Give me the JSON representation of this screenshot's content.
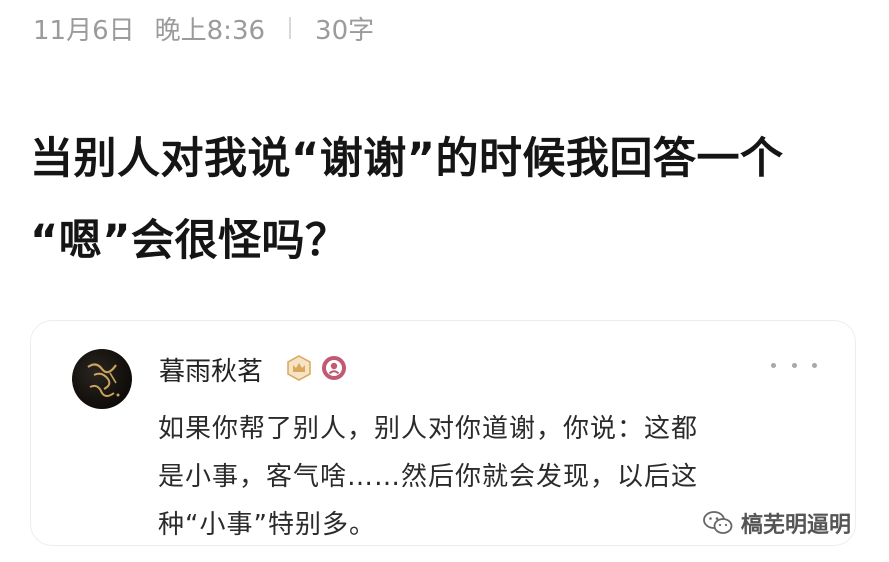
{
  "meta": {
    "date": "11月6日",
    "time": "晚上8:36",
    "word_count": "30字"
  },
  "question": {
    "line1": "当别人对我说“谢谢”的时候我回答一个",
    "line2": "“嗯”会很怪吗？"
  },
  "answer_card": {
    "username": "暮雨秋茗",
    "avatar_text": "暮雨秋茗",
    "lines": [
      "如果你帮了别人，别人对你道谢，你说：这都",
      "是小事，客气啥……然后你就会发现，以后这",
      "种“小事”特别多。"
    ]
  },
  "watermark": {
    "text": "槁芜明逼明",
    "icon": "wechat-icon"
  },
  "colors": {
    "meta_text": "#9b9b9b",
    "title_text": "#151515",
    "body_text": "#2b2b2b",
    "badge_gold": "#d9a85a",
    "badge_pink": "#c05a72"
  }
}
